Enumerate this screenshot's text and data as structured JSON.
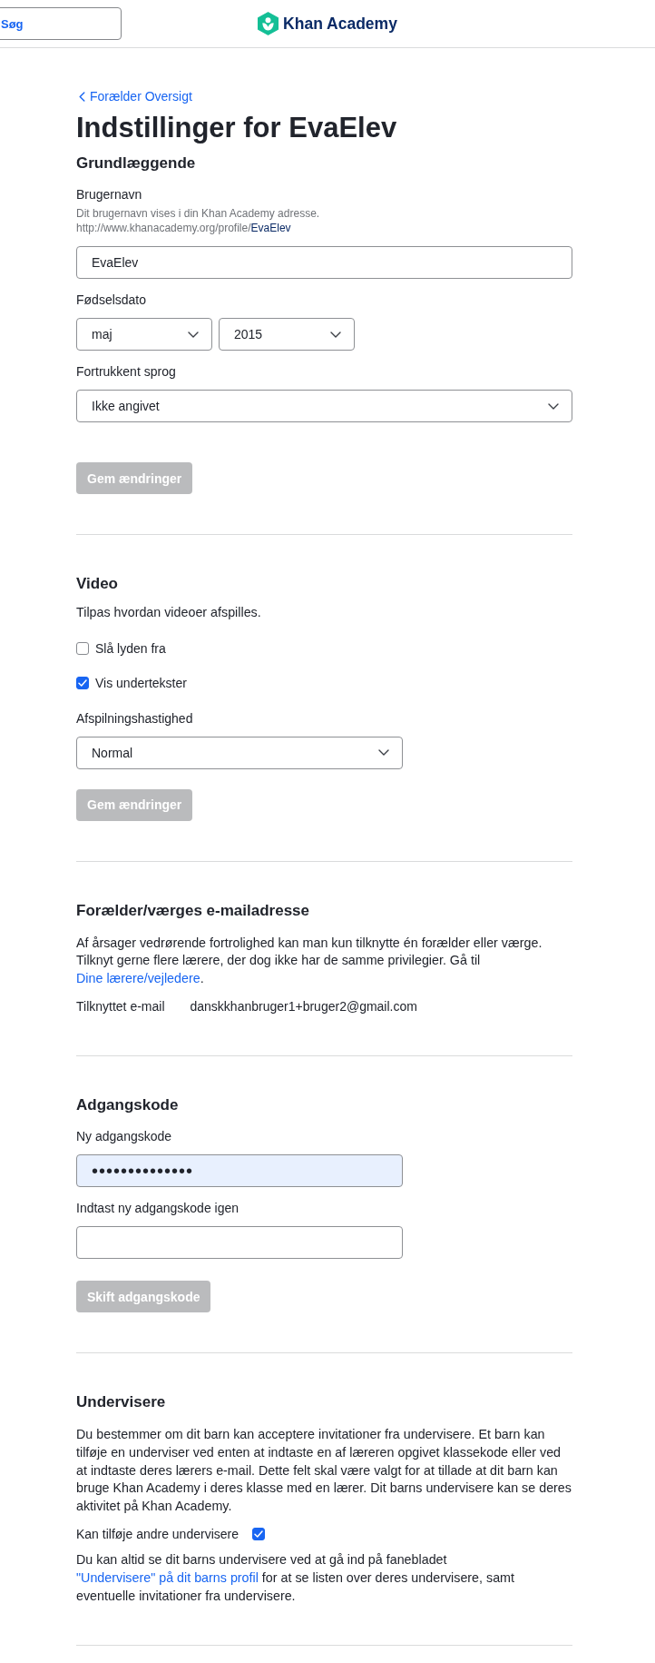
{
  "header": {
    "search": {
      "label": "Søg"
    },
    "logo": {
      "text": "Khan Academy"
    }
  },
  "back_link": {
    "label": "Forælder Oversigt"
  },
  "title": "Indstillinger for EvaElev",
  "sections": [
    {
      "kind": "basic",
      "heading": "Grundlæggende",
      "items": [
        {
          "kind": "text_field",
          "label": "Brugernavn",
          "hint": "Dit brugernavn vises i din Khan Academy adresse.",
          "url": {
            "prefix": "http://www.khanacademy.org/profile/",
            "username": "EvaElev"
          },
          "value": "EvaElev",
          "autofilled": false
        },
        {
          "kind": "select_group",
          "label": "Fødselsdato",
          "selects": [
            {
              "value": "maj"
            },
            {
              "value": "2015"
            }
          ]
        },
        {
          "kind": "select_group",
          "label": "Fortrukkent sprog",
          "selects": [
            {
              "value": "Ikke angivet"
            }
          ]
        },
        {
          "kind": "button",
          "label": "Gem ændringer",
          "disabled": true
        }
      ]
    },
    {
      "kind": "video",
      "heading": "Video",
      "items": [
        {
          "kind": "paragraph",
          "parts": [
            {
              "kind": "text",
              "text": "Tilpas hvordan videoer afspilles."
            }
          ]
        },
        {
          "kind": "checkbox",
          "label": "Slå lyden fra",
          "checked": false
        },
        {
          "kind": "checkbox",
          "label": "Vis undertekster",
          "checked": true
        },
        {
          "kind": "select_group",
          "label": "Afspilningshastighed",
          "selects": [
            {
              "value": "Normal"
            }
          ]
        },
        {
          "kind": "button",
          "label": "Gem ændringer",
          "disabled": true
        }
      ]
    },
    {
      "kind": "guardian_email",
      "heading": "Forælder/værges e-mailadresse",
      "items": [
        {
          "kind": "paragraph",
          "parts": [
            {
              "kind": "text",
              "text": "Af årsager vedrørende fortrolighed kan man kun tilknytte én forælder eller værge. Tilknyt gerne flere lærere, der dog ikke har de samme privilegier. Gå til "
            },
            {
              "kind": "link",
              "text": "Dine lærere/vejledere"
            },
            {
              "kind": "text",
              "text": "."
            }
          ]
        },
        {
          "kind": "info_row",
          "label": "Tilknyttet e-mail",
          "value": "danskkhanbruger1+bruger2@gmail.com"
        }
      ]
    },
    {
      "kind": "password",
      "heading": "Adgangskode",
      "items": [
        {
          "kind": "text_field",
          "label": "Ny adgangskode",
          "value": "••••••••••••••",
          "autofilled": true
        },
        {
          "kind": "text_field",
          "label": "Indtast ny adgangskode igen",
          "autofilled": false
        },
        {
          "kind": "button",
          "label": "Skift adgangskode",
          "disabled": true
        }
      ]
    },
    {
      "kind": "teachers",
      "heading": "Undervisere",
      "items": [
        {
          "kind": "paragraph",
          "parts": [
            {
              "kind": "text",
              "text": "Du bestemmer om dit barn kan acceptere invitationer fra undervisere. Et barn kan tilføje en underviser ved enten at indtaste en af læreren opgivet klassekode eller ved at indtaste deres lærers e-mail. Dette felt skal være valgt for at tillade at dit barn kan bruge Khan Academy i deres klasse med en lærer. Dit barns undervisere kan se deres aktivitet på Khan Academy."
            }
          ]
        },
        {
          "kind": "checkbox_trailing",
          "label": "Kan tilføje andre undervisere",
          "checked": true
        },
        {
          "kind": "paragraph",
          "parts": [
            {
              "kind": "text",
              "text": "Du kan altid se dit barns undervisere ved at gå ind på fanebladet "
            },
            {
              "kind": "link",
              "text": "\"Undervisere\" på dit barns profil"
            },
            {
              "kind": "text",
              "text": " for at se listen over deres undervisere, samt eventuelle invitationer fra undervisere."
            }
          ]
        }
      ]
    }
  ]
}
